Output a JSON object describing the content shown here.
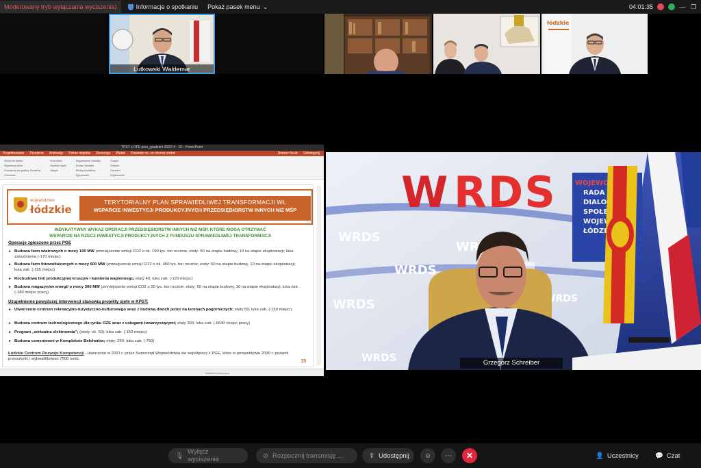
{
  "topbar": {
    "mode_label": "Moderowany tryb wyłączania wyciszenia)",
    "info_label": "Informacje o spotkaniu",
    "menu_label": "Pokaż pasek menu",
    "timer": "04:01:35"
  },
  "participants": [
    {
      "name": "Lutkowski Waldemar",
      "active": true
    },
    {
      "name": ""
    },
    {
      "name": ""
    },
    {
      "name": ""
    }
  ],
  "ppt": {
    "window_title": "TPST z OFE prez_grudzień 2022 l4 - 10 - PowerPoint",
    "tabs": [
      "Projektowanie",
      "Przejścia",
      "Animacje",
      "Pokaz slajdów",
      "Recenzja",
      "Widok",
      "Powiedz mi, co chcesz zrobić"
    ],
    "ribbon_groups": [
      "Czcionka",
      "Akapit",
      "Rysowanie",
      "Edytowanie"
    ],
    "ribbon_items": [
      "Kierunek tekstu",
      "Wyrównaj tekst",
      "Konwertuj na grafikę SmartArt",
      "Rozmieść",
      "Szybkie style",
      "Wypełnienie kształtu",
      "Kontur kształtu",
      "Efekty kształtów",
      "Znajdź",
      "Zamień",
      "Zaznacz"
    ],
    "user": "Roman Szulc",
    "share": "Udostępnij",
    "status": "Notatki   Komentarze"
  },
  "slide": {
    "logo_small": "województwo",
    "logo_big": "łódzkie",
    "title1": "TERYTORIALNY PLAN SPRAWIEDLIWEJ TRANSFORMACJI WŁ",
    "title2": "WSPARCIE INWESTYCJI PRODUKCYJNYCH PRZEDSIĘBIORSTW INNYCH NIŻ MŚP",
    "subhead1": "INDYKATYWNY WYKAZ OPERACJI PRZEDSIĘBIORSTW INNYCH NIŻ MŚP, KTÓRE MOGĄ OTRZYMAĆ",
    "subhead2": "WSPARCIE NA RZECZ INWESTYCJI PRODUKCYJNYCH Z FUNDUSZU SPRAWIEDLIWEJ TRANSFORMACJI",
    "section1": "Operacje zgłoszone przez PGE",
    "items1": [
      {
        "bold": "Budowa farm wiatrowych o mocy 100 MW",
        "rest": " (zmniejszenie emisji CO2 o ok. 190 tys. ton rocznie; etaty: 50 na etapie budowy, 10 na etapie eksploatacji; luka zatrudnienia (-170 miejsc)"
      },
      {
        "bold": "Budowa farm fotowoltaicznych o mocy 600 MW",
        "rest": " (zmniejszenie emisji CO2 o ok. 450 tys. ton rocznie; etaty: 50 na etapie budowy, 10 na etapie eksploatacji; luka zatr. (-195 miejsc)"
      },
      {
        "bold": "Rozbudowa linii produkcyjnej kruszyw i kamienia wapiennego,",
        "rest": " etaty 40; luka zatr. (-120 miejsc)"
      },
      {
        "bold": "Budowa magazynów energii o mocy 300 MW",
        "rest": " (zmniejszenie emisji CO2 o 20 tys. ton rocznie; etaty: 50 na etapie budowy, 10 na etapie eksploatacji; luka zatr. (-180 miejsc pracy)"
      }
    ],
    "section2": "Uzupełnienie powyższej interwencji stanowią projekty ujęte w KPST:",
    "items2": [
      {
        "bold": "Utworzenie centrum rekreacyjno-turystyczno-kulturowego wraz z budową dwóch jezior na terenach pogórniczych;",
        "rest": " etaty 50; luka zatr. (-150 miejsc)"
      },
      {
        "bold": "Budowa centrum technologicznego dla rynku OZE wraz z usługami towarzyszącymi;",
        "rest": " etaty 360; luka zatr. (-6640 miejsc pracy)"
      },
      {
        "bold": "Program „wirtualna elektrownia\";",
        "rest": " (etaty: ok. 50); luka zatr. (-150 miejsc)"
      },
      {
        "bold": "Budowa cementowni w Kompleksie Bełchatów;",
        "rest": " etaty: 250; luka zatr. (-750)"
      }
    ],
    "footer_bold": "Łódzkie Centrum Rozwoju Kompetencji",
    "footer_rest": " - utworzone w 2021 r. przez Samorząd Województwa we współpracy z PGE, które w perspektywie 2030 r. pozwoli przeszkolić i wykwalifikować 7500 osób.",
    "page": "15"
  },
  "speaker": {
    "name": "Grzegorz Schreiber",
    "wall_brand": "WRDS",
    "wall_small": "WRDS",
    "roll_lines": [
      "WOJEWODZ",
      "RADA",
      "DIALOGU",
      "SPOŁECZN",
      "WOJEWO",
      "ŁÓDZKIE"
    ]
  },
  "toolbar": {
    "unmute": "Wyłącz wyciszenie",
    "stream": "Rozpocznij transmisję ...",
    "share": "Udostępnij",
    "participants": "Uczestnicy",
    "chat": "Czat"
  },
  "colors": {
    "accent_orange": "#c8642a",
    "accent_green": "#3d8b2a",
    "end_call": "#e0293d",
    "active_speaker": "#3aa0e8"
  }
}
